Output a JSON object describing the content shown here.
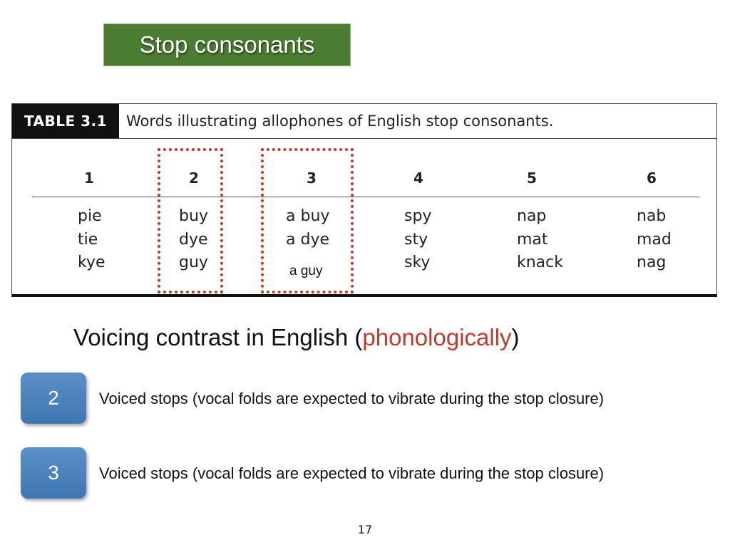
{
  "slide": {
    "title": "Stop consonants",
    "page_number": "17"
  },
  "table": {
    "tag": "TABLE 3.1",
    "caption": "Words illustrating allophones of English stop consonants.",
    "columns": [
      {
        "header": "1",
        "words": [
          "pie",
          "tie",
          "kye"
        ]
      },
      {
        "header": "2",
        "words": [
          "buy",
          "dye",
          "guy"
        ]
      },
      {
        "header": "3",
        "words": [
          "a buy",
          "a dye",
          ""
        ]
      },
      {
        "header": "4",
        "words": [
          "spy",
          "sty",
          "sky"
        ]
      },
      {
        "header": "5",
        "words": [
          "nap",
          "mat",
          "knack"
        ]
      },
      {
        "header": "6",
        "words": [
          "nab",
          "mad",
          "nag"
        ]
      }
    ],
    "overlay_label": "a guy",
    "highlight_color": "#c0392b"
  },
  "heading": {
    "prefix": "Voicing contrast in English (",
    "accent": "phonologically",
    "suffix": ")",
    "accent_color": "#c0392b"
  },
  "rows": [
    {
      "badge": "2",
      "text": "Voiced stops (vocal folds are expected to vibrate during the stop closure)"
    },
    {
      "badge": "3",
      "text": "Voiced stops (vocal folds are expected to vibrate during the stop closure)"
    }
  ],
  "colors": {
    "title_bg": "#4a7c31",
    "badge": "#4a80bd"
  }
}
